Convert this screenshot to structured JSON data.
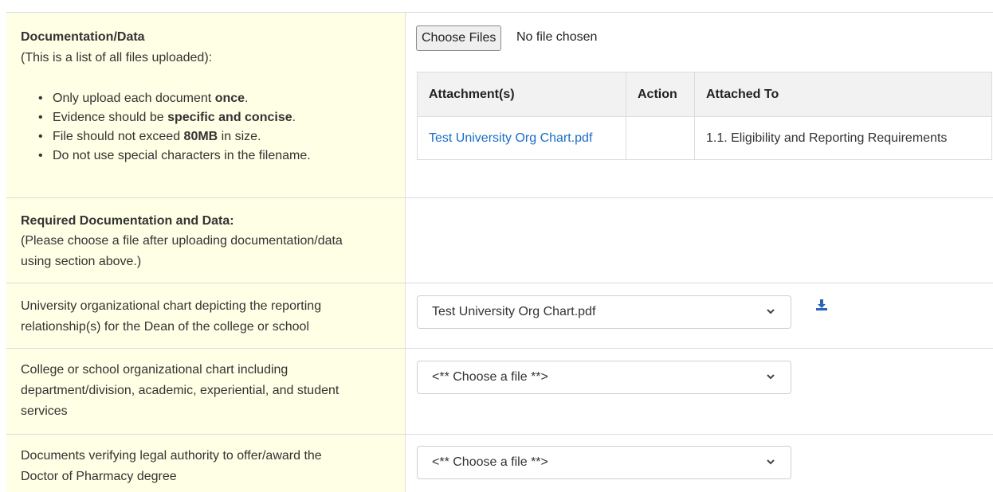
{
  "upload_section": {
    "heading": "Documentation/Data",
    "subheading": "(This is a list of all files uploaded):",
    "bullets": [
      {
        "pre": "Only upload each document ",
        "bold": "once",
        "post": "."
      },
      {
        "pre": "Evidence should be ",
        "bold": "specific and concise",
        "post": "."
      },
      {
        "pre": "File should not exceed ",
        "bold": "80MB",
        "post": " in size."
      },
      {
        "pre": "Do not use special characters in the filename.",
        "bold": "",
        "post": ""
      }
    ],
    "choose_files_label": "Choose Files",
    "file_status": "No file chosen",
    "table": {
      "headers": [
        "Attachment(s)",
        "Action",
        "Attached To"
      ],
      "rows": [
        {
          "attachment": "Test University Org Chart.pdf",
          "action": "",
          "attached_to": "1.1. Eligibility and Reporting Requirements"
        }
      ]
    }
  },
  "required_section": {
    "heading": "Required Documentation and Data:",
    "note_line1": "(Please choose a file after uploading documentation/data",
    "note_line2": "using section above.)"
  },
  "requirements": [
    {
      "line1": "University organizational chart depicting the reporting",
      "line2": "relationship(s) for the Dean of the college or school",
      "line3": "",
      "selected": "Test University Org Chart.pdf",
      "download_icon": "download-icon"
    },
    {
      "line1": "College or school organizational chart including",
      "line2": "department/division, academic, experiential, and student",
      "line3": "services",
      "selected": "<** Choose a file **>"
    },
    {
      "line1": "Documents verifying legal authority to offer/award the",
      "line2": "Doctor of Pharmacy degree",
      "line3": "",
      "selected": "<** Choose a file **>"
    }
  ],
  "colors": {
    "label_background": "#ffffe6",
    "link": "#1a6ec7",
    "download_icon": "#2a63b8"
  }
}
